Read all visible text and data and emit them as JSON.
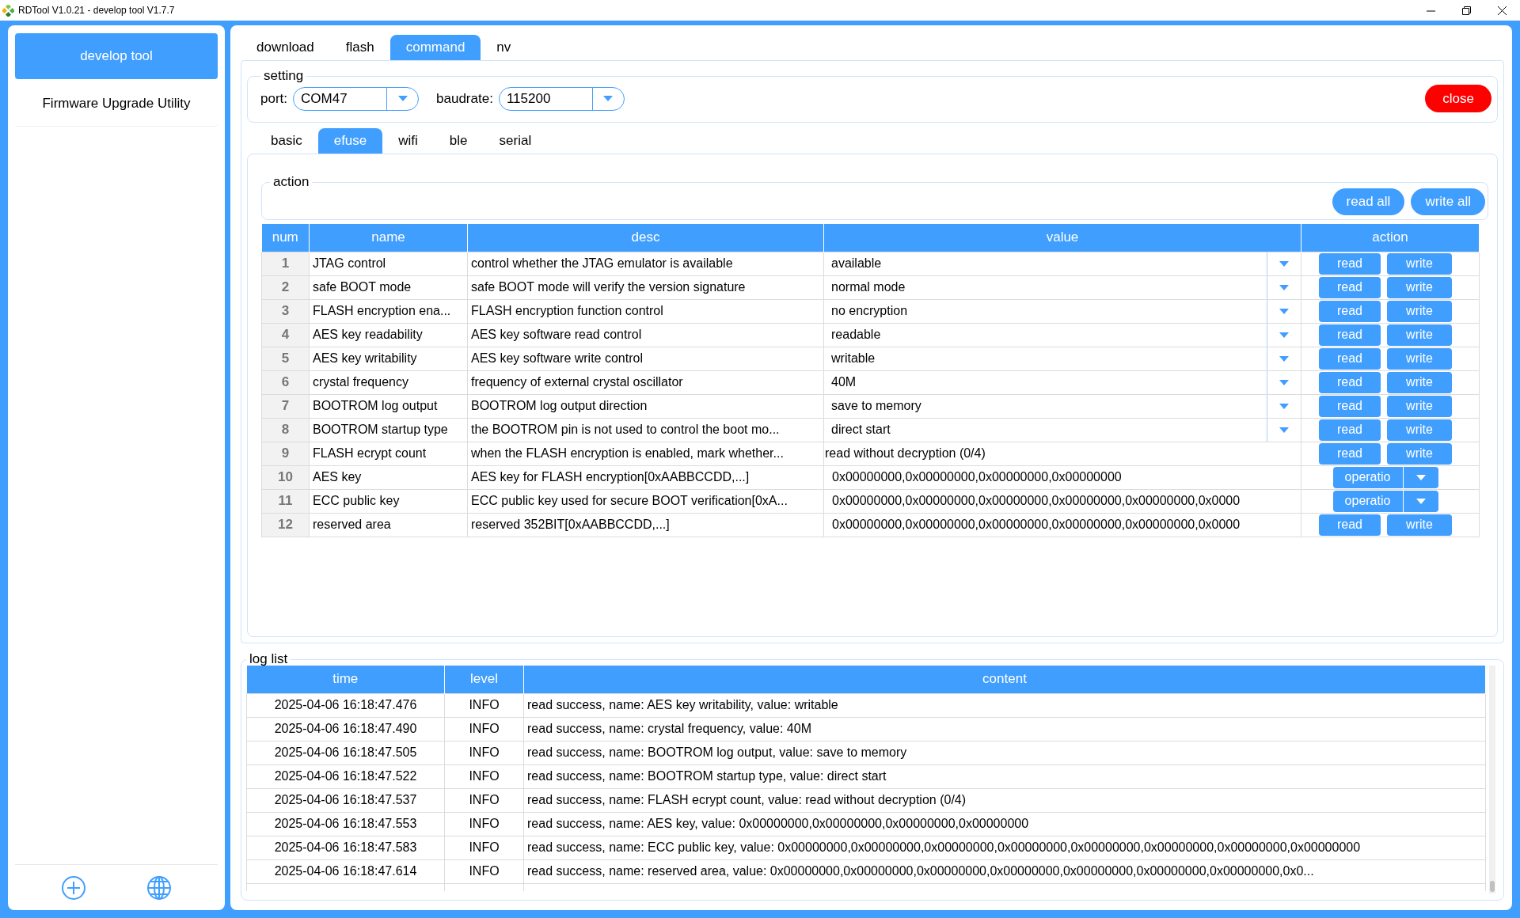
{
  "window": {
    "title": "RDTool V1.0.21 - develop tool V1.7.7"
  },
  "sidebar": {
    "items": [
      {
        "label": "develop tool",
        "selected": true
      },
      {
        "label": "Firmware Upgrade Utility",
        "selected": false
      }
    ]
  },
  "tabs": [
    {
      "label": "download",
      "selected": false
    },
    {
      "label": "flash",
      "selected": false
    },
    {
      "label": "command",
      "selected": true
    },
    {
      "label": "nv",
      "selected": false
    }
  ],
  "setting": {
    "title": "setting",
    "port": {
      "label": "port:",
      "value": "COM47"
    },
    "baudrate": {
      "label": "baudrate:",
      "value": "115200"
    },
    "close_button": "close"
  },
  "sub_tabs": [
    {
      "label": "basic",
      "selected": false
    },
    {
      "label": "efuse",
      "selected": true
    },
    {
      "label": "wifi",
      "selected": false
    },
    {
      "label": "ble",
      "selected": false
    },
    {
      "label": "serial",
      "selected": false
    }
  ],
  "action_group": {
    "title": "action",
    "buttons": [
      "read all",
      "write all"
    ]
  },
  "table": {
    "columns": [
      "num",
      "name",
      "desc",
      "value",
      "action"
    ],
    "rows": [
      {
        "num": "1",
        "name": "JTAG control",
        "desc": "control whether the JTAG emulator is available",
        "value": "available",
        "kind": "select",
        "actions": {
          "kind": "pair",
          "labels": [
            "read",
            "write"
          ]
        }
      },
      {
        "num": "2",
        "name": "safe BOOT mode",
        "desc": "safe BOOT mode will verify the version signature",
        "value": "normal mode",
        "kind": "select",
        "actions": {
          "kind": "pair",
          "labels": [
            "read",
            "write"
          ]
        }
      },
      {
        "num": "3",
        "name": "FLASH encryption ena...",
        "desc": "FLASH encryption function control",
        "value": "no encryption",
        "kind": "select",
        "actions": {
          "kind": "pair",
          "labels": [
            "read",
            "write"
          ]
        }
      },
      {
        "num": "4",
        "name": "AES key readability",
        "desc": "AES key software read control",
        "value": "readable",
        "kind": "select",
        "actions": {
          "kind": "pair",
          "labels": [
            "read",
            "write"
          ]
        }
      },
      {
        "num": "5",
        "name": "AES key writability",
        "desc": "AES key software write control",
        "value": "writable",
        "kind": "select",
        "actions": {
          "kind": "pair",
          "labels": [
            "read",
            "write"
          ]
        }
      },
      {
        "num": "6",
        "name": "crystal frequency",
        "desc": "frequency of external crystal oscillator",
        "value": "40M",
        "kind": "select",
        "actions": {
          "kind": "pair",
          "labels": [
            "read",
            "write"
          ]
        }
      },
      {
        "num": "7",
        "name": "BOOTROM log output",
        "desc": "BOOTROM log output direction",
        "value": "save to memory",
        "kind": "select",
        "actions": {
          "kind": "pair",
          "labels": [
            "read",
            "write"
          ]
        }
      },
      {
        "num": "8",
        "name": "BOOTROM startup type",
        "desc": "the BOOTROM pin is not used to control the boot mo...",
        "value": "direct start",
        "kind": "select",
        "actions": {
          "kind": "pair",
          "labels": [
            "read",
            "write"
          ]
        }
      },
      {
        "num": "9",
        "name": "FLASH ecrypt count",
        "desc": "when the FLASH encryption is enabled, mark whether...",
        "value": "read without decryption (0/4)",
        "kind": "text",
        "actions": {
          "kind": "pair",
          "labels": [
            "read",
            "write"
          ]
        }
      },
      {
        "num": "10",
        "name": "AES key",
        "desc": "AES key for FLASH encryption[0xAABBCCDD,...]",
        "value": "0x00000000,0x00000000,0x00000000,0x00000000",
        "kind": "input",
        "actions": {
          "kind": "split",
          "labels": [
            "operatio"
          ]
        }
      },
      {
        "num": "11",
        "name": "ECC public key",
        "desc": "ECC public key used for secure BOOT verification[0xA...",
        "value": "0x00000000,0x00000000,0x00000000,0x00000000,0x00000000,0x0000",
        "kind": "input",
        "actions": {
          "kind": "split",
          "labels": [
            "operatio"
          ]
        }
      },
      {
        "num": "12",
        "name": "reserved area",
        "desc": "reserved 352BIT[0xAABBCCDD,...]",
        "value": "0x00000000,0x00000000,0x00000000,0x00000000,0x00000000,0x0000",
        "kind": "input",
        "actions": {
          "kind": "pair",
          "labels": [
            "read",
            "write"
          ]
        }
      }
    ]
  },
  "log": {
    "title": "log list",
    "columns": [
      "time",
      "level",
      "content"
    ],
    "rows": [
      {
        "time": "2025-04-06 16:18:47.476",
        "level": "INFO",
        "content": "read success, name: AES key writability, value: writable"
      },
      {
        "time": "2025-04-06 16:18:47.490",
        "level": "INFO",
        "content": "read success, name: crystal frequency, value: 40M"
      },
      {
        "time": "2025-04-06 16:18:47.505",
        "level": "INFO",
        "content": "read success, name: BOOTROM log output, value: save to memory"
      },
      {
        "time": "2025-04-06 16:18:47.522",
        "level": "INFO",
        "content": "read success, name: BOOTROM startup type, value: direct start"
      },
      {
        "time": "2025-04-06 16:18:47.537",
        "level": "INFO",
        "content": "read success, name: FLASH ecrypt count, value: read without decryption (0/4)"
      },
      {
        "time": "2025-04-06 16:18:47.553",
        "level": "INFO",
        "content": "read success, name: AES key, value: 0x00000000,0x00000000,0x00000000,0x00000000"
      },
      {
        "time": "2025-04-06 16:18:47.583",
        "level": "INFO",
        "content": "read success, name: ECC public key, value: 0x00000000,0x00000000,0x00000000,0x00000000,0x00000000,0x00000000,0x00000000,0x00000000"
      },
      {
        "time": "2025-04-06 16:18:47.614",
        "level": "INFO",
        "content": "read success, name: reserved area, value: 0x00000000,0x00000000,0x00000000,0x00000000,0x00000000,0x00000000,0x00000000,0x0..."
      }
    ]
  }
}
